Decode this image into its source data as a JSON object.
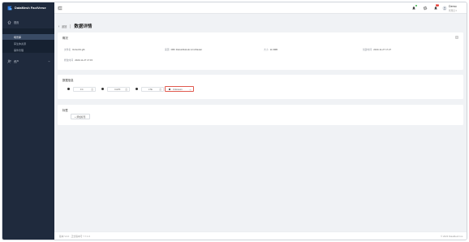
{
  "app": {
    "brand": "DataMesh FactVerse",
    "brand_color": "#2f7de1"
  },
  "sidebar": {
    "items": [
      {
        "label": "首页",
        "icon": "home-icon"
      },
      {
        "label": "数字孪生",
        "icon": "cube-icon"
      },
      {
        "label": "资产",
        "icon": "users-icon"
      }
    ],
    "submenu": [
      {
        "label": "场景库",
        "active": true
      },
      {
        "label": "孪生体资源",
        "active": false
      },
      {
        "label": "事件管理",
        "active": false
      }
    ]
  },
  "header": {
    "notification_badge": "99",
    "user": {
      "name": "Demo",
      "role": "管理员 ▾"
    }
  },
  "page": {
    "back_label": "返回",
    "title": "数据详情"
  },
  "info_card": {
    "title": "概况",
    "fields": [
      {
        "label": "文件名",
        "value": "Robot01.glb"
      },
      {
        "label": "来源",
        "value": "FBX Robot/Robotic Arm/Model"
      },
      {
        "label": "大小",
        "value": "11.9MB"
      },
      {
        "label": "创建时间",
        "value": "2023-11-27 17:27"
      },
      {
        "label": "修改时间",
        "value": "2023-11-27 17:15"
      }
    ]
  },
  "filter_card": {
    "title": "数据信息",
    "inputs": [
      {
        "value": "FC",
        "unit": "台"
      },
      {
        "value": "CAPF",
        "unit": "台"
      },
      {
        "value": "LTE",
        "unit": "台"
      }
    ],
    "select": {
      "value": "Unknown"
    }
  },
  "tag_card": {
    "title": "标签",
    "add_label": "+ 添加标签"
  },
  "footer": {
    "left": "版本 V4.0 · 正式版本号 7.7.1.6",
    "right": "© 2023 DataMesh Inc."
  }
}
